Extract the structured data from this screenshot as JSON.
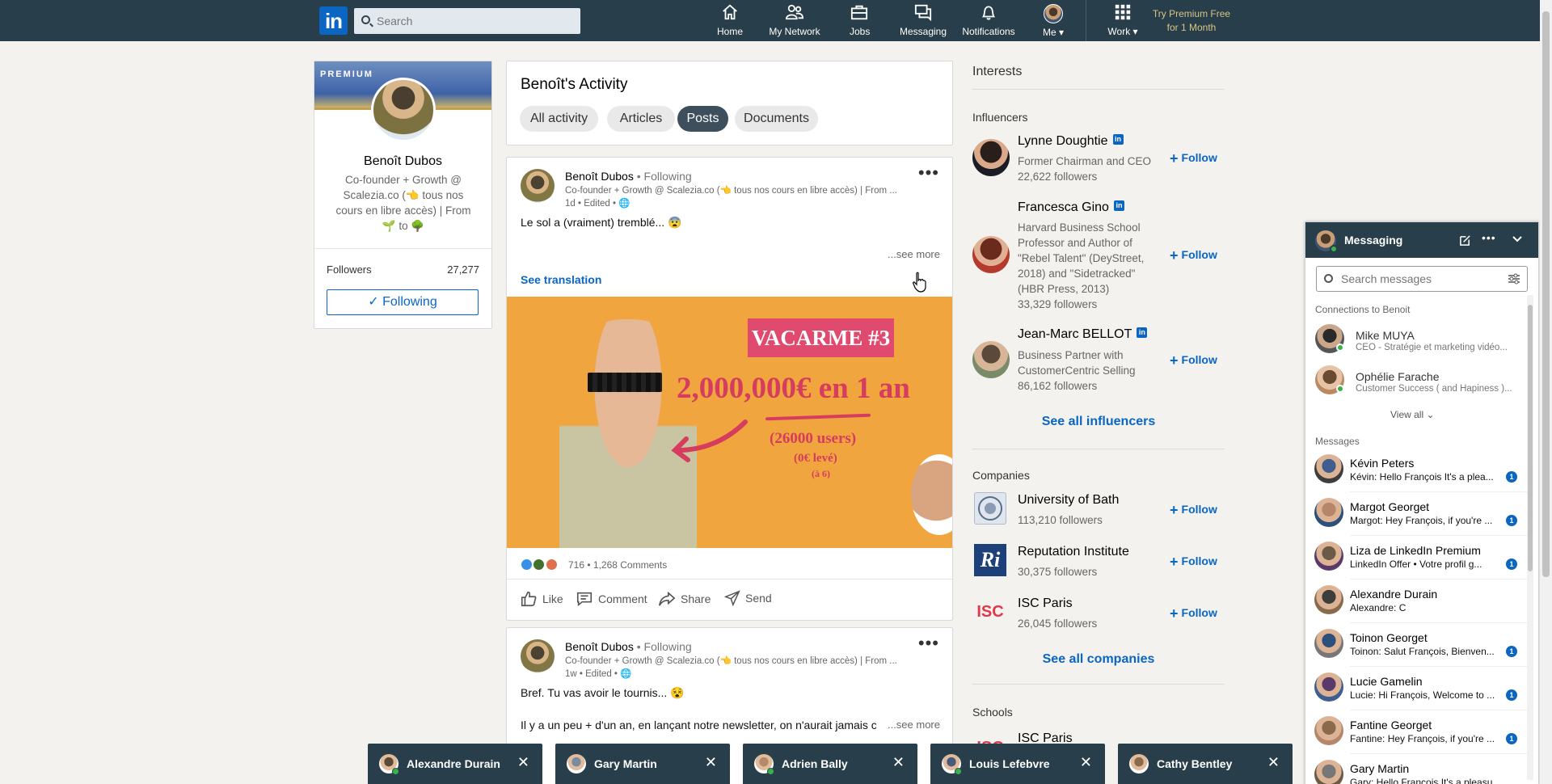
{
  "nav": {
    "logo": "in",
    "search_placeholder": "Search",
    "items": [
      {
        "label": "Home",
        "icon": "home-icon"
      },
      {
        "label": "My Network",
        "icon": "network-icon"
      },
      {
        "label": "Jobs",
        "icon": "briefcase-icon"
      },
      {
        "label": "Messaging",
        "icon": "chat-icon"
      },
      {
        "label": "Notifications",
        "icon": "bell-icon"
      },
      {
        "label": "Me",
        "icon": "avatar"
      },
      {
        "label": "Work",
        "icon": "grid-icon"
      }
    ],
    "premium_line1": "Try Premium Free",
    "premium_line2": "for 1 Month"
  },
  "profile": {
    "premium_tag": "PREMIUM",
    "name": "Benoît Dubos",
    "headline": "Co-founder + Growth @ Scalezia.co (👈 tous nos cours en libre accès) | From 🌱 to 🌳",
    "followers_label": "Followers",
    "followers_count": "27,277",
    "following_label": "✓ Following"
  },
  "activity": {
    "title": "Benoît's Activity",
    "tabs": [
      "All activity",
      "Articles",
      "Posts",
      "Documents"
    ],
    "active_tab": "Posts"
  },
  "posts": [
    {
      "author": "Benoît Dubos",
      "relation": "• Following",
      "subtitle": "Co-founder + Growth @ Scalezia.co (👈 tous nos cours en libre accès) | From ...",
      "time": "1d • Edited • 🌐",
      "text": "Le sol a (vraiment) tremblé... 😨",
      "see_more": "...see more",
      "see_translation": "See translation",
      "image": {
        "banner": "VACARME #3",
        "headline": "2,000,000€ en 1 an",
        "users": "(26000 users)",
        "raised": "(0€ levé)",
        "sub": "(à 6)"
      },
      "reaction_count": "716 • 1,268 Comments",
      "actions": [
        "Like",
        "Comment",
        "Share",
        "Send"
      ]
    },
    {
      "author": "Benoît Dubos",
      "relation": "• Following",
      "subtitle": "Co-founder + Growth @ Scalezia.co (👈 tous nos cours en libre accès) | From ...",
      "time": "1w • Edited • 🌐",
      "text": "Bref. Tu vas avoir le tournis... 😵",
      "text2": "Il y a un peu + d'un an, en lançant notre newsletter, on n'aurait jamais cr",
      "see_more": "...see more"
    }
  ],
  "interests": {
    "title": "Interests",
    "influencers_title": "Influencers",
    "influencers": [
      {
        "name": "Lynne Doughtie",
        "desc": "Former Chairman and CEO",
        "followers": "22,622 followers"
      },
      {
        "name": "Francesca Gino",
        "desc": "Harvard Business School Professor and Author of \"Rebel Talent\" (DeyStreet, 2018) and \"Sidetracked\" (HBR Press, 2013)",
        "followers": "33,329 followers"
      },
      {
        "name": "Jean-Marc BELLOT",
        "desc": "Business Partner with CustomerCentric Selling",
        "followers": "86,162 followers"
      }
    ],
    "follow_label": "Follow",
    "see_all_influencers": "See all influencers",
    "companies_title": "Companies",
    "companies": [
      {
        "name": "University of Bath",
        "followers": "113,210 followers"
      },
      {
        "name": "Reputation Institute",
        "followers": "30,375 followers"
      },
      {
        "name": "ISC Paris",
        "followers": "26,045 followers"
      }
    ],
    "see_all_companies": "See all companies",
    "schools_title": "Schools",
    "schools": [
      {
        "name": "ISC Paris"
      }
    ],
    "company_logo_text": [
      "",
      "Ri",
      "ISC"
    ]
  },
  "messaging": {
    "title": "Messaging",
    "search_placeholder": "Search messages",
    "connections_title": "Connections to Benoit",
    "connections": [
      {
        "name": "Mike MUYA",
        "sub": "CEO - Stratégie et marketing vidéo..."
      },
      {
        "name": "Ophélie Farache",
        "sub": "Customer Success ( and Hapiness )..."
      }
    ],
    "view_all": "View all",
    "messages_title": "Messages",
    "messages": [
      {
        "name": "Kévin Peters",
        "preview": "Kévin: Hello François It's a plea...",
        "badge": "1"
      },
      {
        "name": "Margot Georget",
        "preview": "Margot: Hey François, if you're ...",
        "badge": "1"
      },
      {
        "name": "Liza de LinkedIn Premium",
        "preview": "LinkedIn Offer •  Votre profil g...",
        "badge": "1"
      },
      {
        "name": "Alexandre Durain",
        "preview": "Alexandre: C",
        "badge": ""
      },
      {
        "name": "Toinon Georget",
        "preview": "Toinon: Salut François, Bienven...",
        "badge": "1"
      },
      {
        "name": "Lucie Gamelin",
        "preview": "Lucie: Hi François, Welcome to ...",
        "badge": "1"
      },
      {
        "name": "Fantine Georget",
        "preview": "Fantine: Hey François, if you're ...",
        "badge": "1"
      },
      {
        "name": "Gary Martin",
        "preview": "Gary: Hello François It's a pleasu...",
        "badge": ""
      }
    ]
  },
  "chat_tabs": [
    {
      "name": "Alexandre Durain",
      "online": true
    },
    {
      "name": "Gary Martin",
      "online": false
    },
    {
      "name": "Adrien Bally",
      "online": true
    },
    {
      "name": "Louis Lefebvre",
      "online": true
    },
    {
      "name": "Cathy Bentley",
      "online": false
    }
  ],
  "colors": {
    "nav_bg": "#283e4a",
    "accent": "#0a66c2",
    "premium": "#d8c486",
    "online": "#37b34a"
  }
}
